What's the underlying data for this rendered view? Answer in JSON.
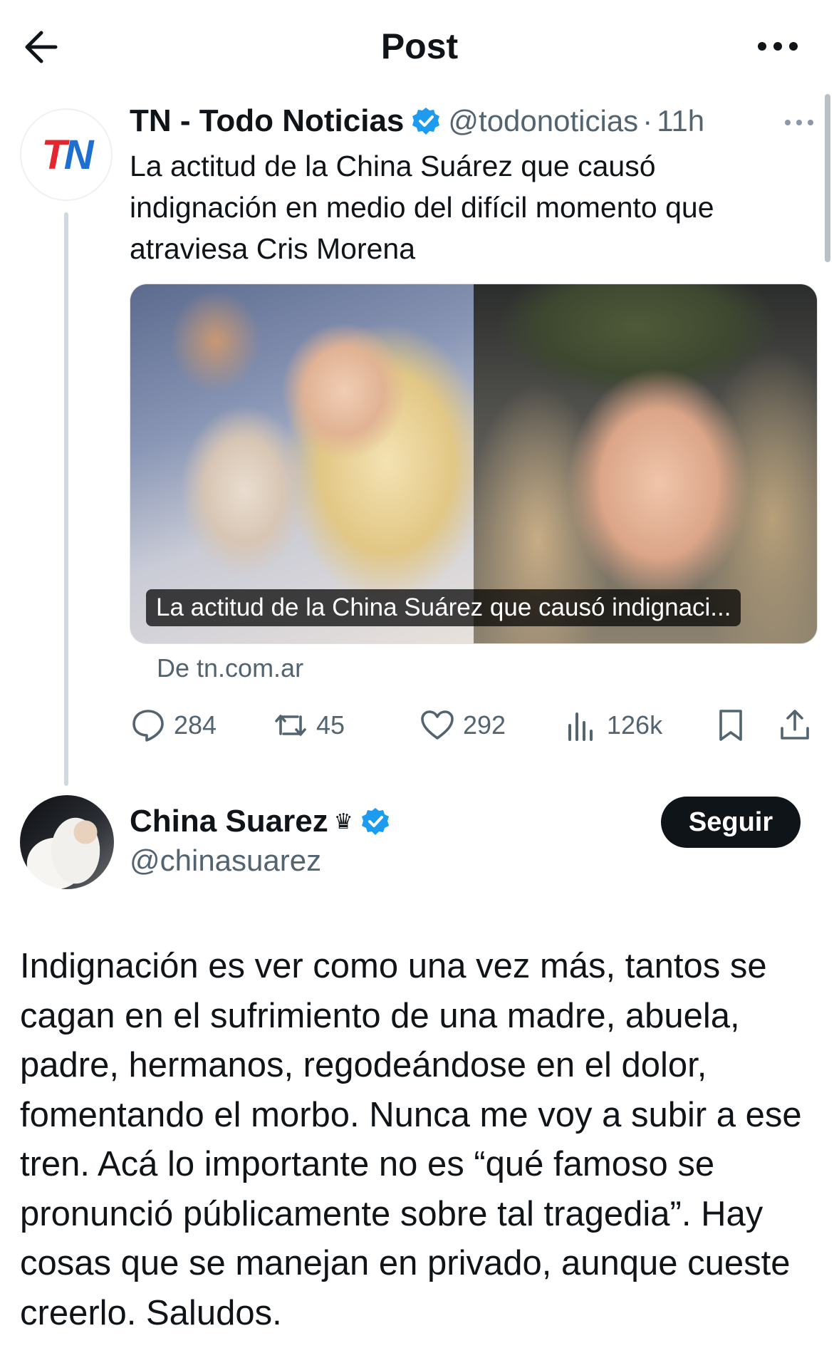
{
  "header": {
    "title": "Post",
    "back_icon": "arrow-left-icon",
    "more_icon": "more-horizontal-icon"
  },
  "quoted_post": {
    "avatar_text": "TN",
    "name": "TN - Todo Noticias",
    "handle": "@todonoticias",
    "time": "11h",
    "text": "La actitud de la China Suárez que causó indignación en medio del difícil momento que atraviesa Cris Morena",
    "card_caption": "La actitud de la China Suárez que causó indignaci...",
    "card_source": "De tn.com.ar",
    "actions": {
      "replies": "284",
      "reposts": "45",
      "likes": "292",
      "views": "126k"
    }
  },
  "post": {
    "name": "China Suarez",
    "name_symbol": "♛",
    "handle": "@chinasuarez",
    "follow_label": "Seguir",
    "text": "Indignación es ver como una vez más, tantos se cagan en el sufrimiento de una madre, abuela, padre, hermanos, regodeándose en el dolor, fomentando el morbo. Nunca me voy a subir a ese tren. Acá lo importante no es “qué famoso se pronunció públicamente sobre tal tragedia”. Hay cosas que se manejan en privado, aunque cueste creerlo. Saludos."
  },
  "colors": {
    "verified": "#1d9bf0",
    "text": "#0f1419",
    "secondary": "#536471",
    "follow_bg": "#0f1419"
  }
}
